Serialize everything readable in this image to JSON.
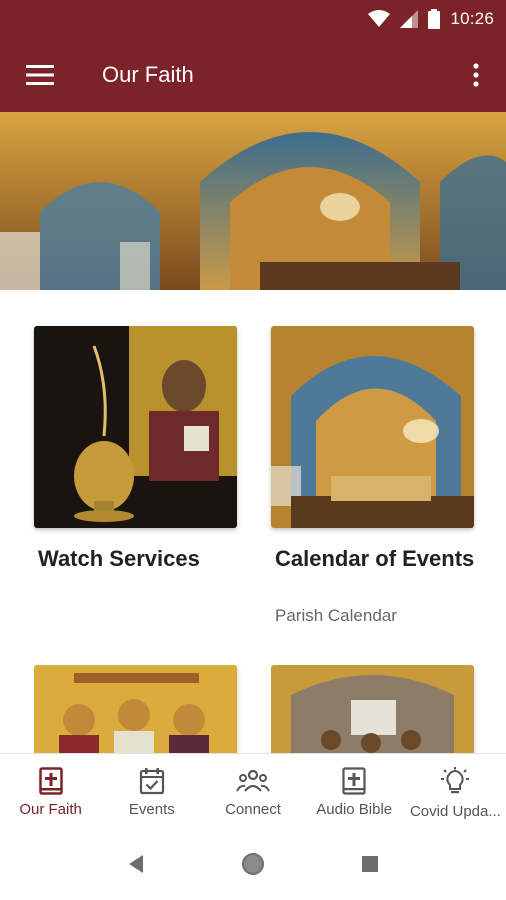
{
  "status_bar": {
    "time": "10:26"
  },
  "app_bar": {
    "title": "Our Faith"
  },
  "cards": [
    {
      "title": "Watch Services",
      "subtitle": ""
    },
    {
      "title": "Calendar of Events",
      "subtitle": "Parish Calendar"
    },
    {
      "title": "",
      "subtitle": ""
    },
    {
      "title": "",
      "subtitle": ""
    }
  ],
  "bottom_nav": {
    "items": [
      {
        "label": "Our Faith",
        "icon": "bible-cross-icon",
        "active": true
      },
      {
        "label": "Events",
        "icon": "calendar-check-icon",
        "active": false
      },
      {
        "label": "Connect",
        "icon": "people-group-icon",
        "active": false
      },
      {
        "label": "Audio Bible",
        "icon": "bible-cross-icon",
        "active": false
      },
      {
        "label": "Covid Upda...",
        "icon": "lightbulb-icon",
        "active": false
      }
    ]
  },
  "colors": {
    "primary": "#7b2328",
    "nav_inactive": "#555555",
    "card_title": "#222222",
    "card_subtitle": "#666666"
  }
}
